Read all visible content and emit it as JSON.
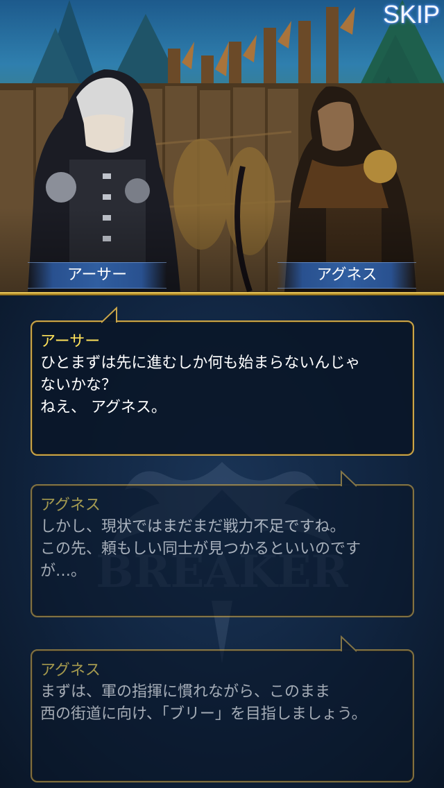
{
  "skip": {
    "label": "SKIP"
  },
  "characters": {
    "left": {
      "name": "アーサー"
    },
    "right": {
      "name": "アグネス"
    }
  },
  "dialogs": [
    {
      "speaker": "アーサー",
      "lines": [
        "ひとまずは先に進むしか何も始まらないんじゃ",
        "ないかな？",
        "ねえ、 アグネス。"
      ],
      "active": true
    },
    {
      "speaker": "アグネス",
      "lines": [
        "しかし、現状ではまだまだ戦力不足ですね。",
        "この先、頼もしい同士が見つかるといいのです",
        "が…。"
      ],
      "active": false
    },
    {
      "speaker": "アグネス",
      "lines": [
        "まずは、軍の指揮に慣れながら、このまま",
        "西の街道に向け、「ブリー」を目指しましょう。"
      ],
      "active": false
    }
  ],
  "watermark": {
    "logo_text": "BREAKER"
  },
  "colors": {
    "speaker": "#ffe25a",
    "border": "#c9a54a",
    "text": "#ffffff",
    "panel": "#0c1a2e"
  }
}
